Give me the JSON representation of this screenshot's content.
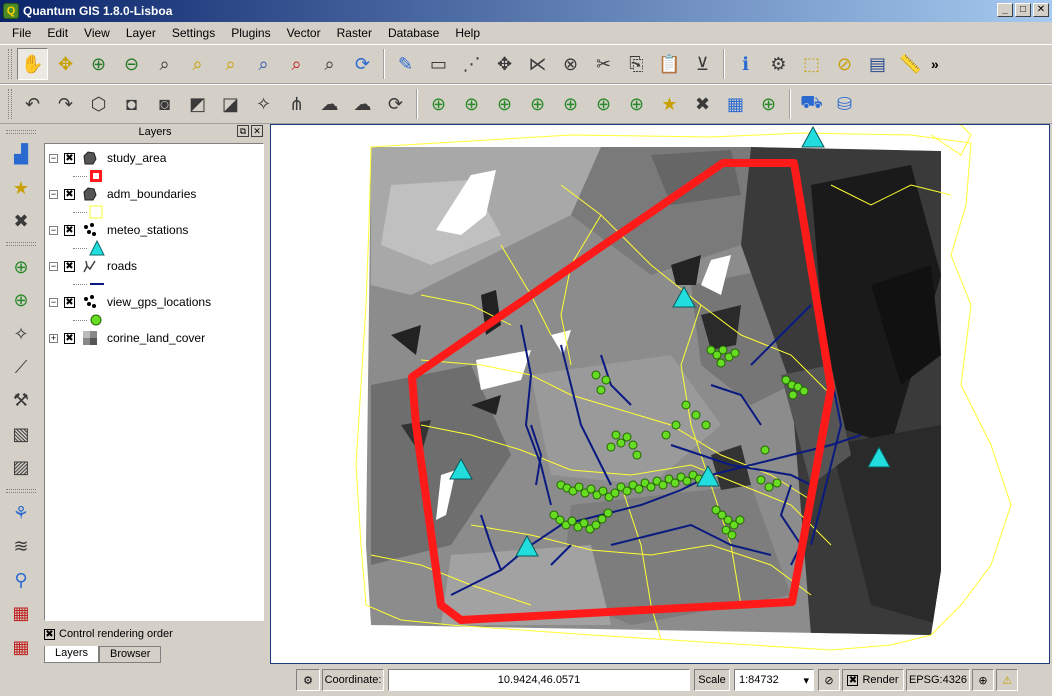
{
  "window": {
    "title": "Quantum GIS 1.8.0-Lisboa",
    "controls": [
      "_",
      "□",
      "✕"
    ]
  },
  "menu": [
    "File",
    "Edit",
    "View",
    "Layer",
    "Settings",
    "Plugins",
    "Vector",
    "Raster",
    "Database",
    "Help"
  ],
  "toolbar_overflow": "»",
  "layers_panel": {
    "title": "Layers",
    "layers": [
      {
        "name": "study_area",
        "checked": "✖",
        "expander": "−"
      },
      {
        "name": "adm_boundaries",
        "checked": "✖",
        "expander": "−"
      },
      {
        "name": "meteo_stations",
        "checked": "✖",
        "expander": "−"
      },
      {
        "name": "roads",
        "checked": "✖",
        "expander": "−"
      },
      {
        "name": "view_gps_locations",
        "checked": "✖",
        "expander": "−"
      },
      {
        "name": "corine_land_cover",
        "checked": "✖",
        "expander": "+"
      }
    ],
    "control_rendering_order": "Control rendering order",
    "control_rendering_checked": "✖",
    "tabs": [
      "Layers",
      "Browser"
    ]
  },
  "status": {
    "coordinate_label": "Coordinate:",
    "coordinate_value": "10.9424,46.0571",
    "scale_label": "Scale",
    "scale_value": "1:84732",
    "render_label": "Render",
    "render_checked": "✖",
    "epsg": "EPSG:4326"
  },
  "colors": {
    "study_area": "#ff1a1a",
    "adm_boundaries": "#ffff33",
    "roads": "#0a1a80",
    "gps": "#66dd22",
    "meteo": "#22dddd"
  }
}
